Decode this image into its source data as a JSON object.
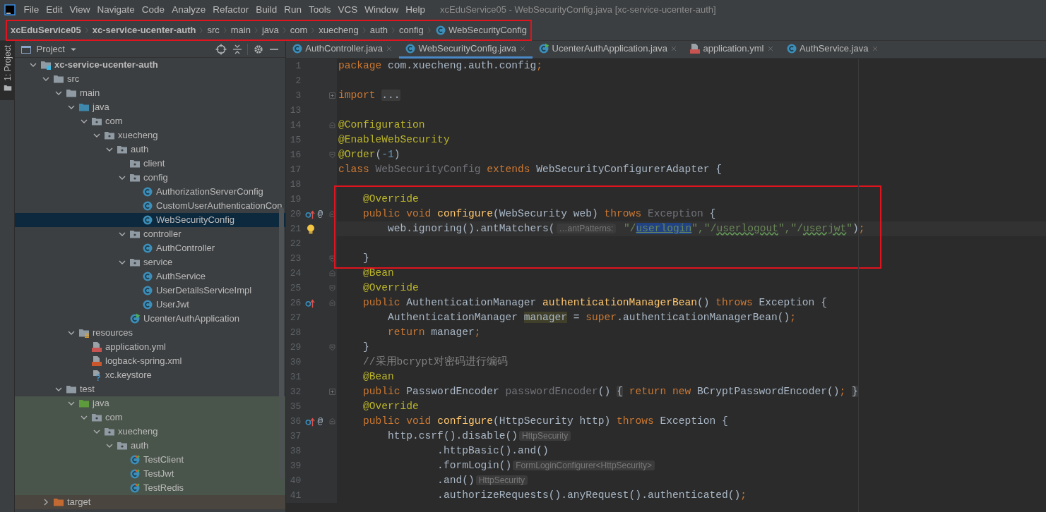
{
  "menu_bar": {
    "items": [
      "File",
      "Edit",
      "View",
      "Navigate",
      "Code",
      "Analyze",
      "Refactor",
      "Build",
      "Run",
      "Tools",
      "VCS",
      "Window",
      "Help"
    ],
    "title": "xcEduService05 - WebSecurityConfig.java [xc-service-ucenter-auth]"
  },
  "breadcrumb": {
    "outlined": true,
    "items": [
      {
        "text": "xcEduService05",
        "kind": "project"
      },
      {
        "text": "xc-service-ucenter-auth",
        "kind": "project"
      },
      {
        "text": "src",
        "kind": "dir"
      },
      {
        "text": "main",
        "kind": "dir"
      },
      {
        "text": "java",
        "kind": "dir"
      },
      {
        "text": "com",
        "kind": "dir"
      },
      {
        "text": "xuecheng",
        "kind": "dir"
      },
      {
        "text": "auth",
        "kind": "dir"
      },
      {
        "text": "config",
        "kind": "dir"
      },
      {
        "text": "WebSecurityConfig",
        "kind": "class"
      }
    ]
  },
  "tool_strip": {
    "label": "1: Project"
  },
  "project_panel": {
    "title": "Project",
    "tree": [
      {
        "label": "xc-service-ucenter-auth",
        "kind": "module",
        "expanded": true,
        "selected": false,
        "children": [
          {
            "label": "src",
            "kind": "folder",
            "expanded": true,
            "selected": false,
            "children": [
              {
                "label": "main",
                "kind": "folder",
                "expanded": true,
                "selected": false,
                "children": [
                  {
                    "label": "java",
                    "kind": "source-root",
                    "expanded": true,
                    "selected": false,
                    "children": [
                      {
                        "label": "com",
                        "kind": "package",
                        "expanded": true,
                        "selected": false,
                        "children": [
                          {
                            "label": "xuecheng",
                            "kind": "package",
                            "expanded": true,
                            "selected": false,
                            "children": [
                              {
                                "label": "auth",
                                "kind": "package",
                                "expanded": true,
                                "selected": false,
                                "children": [
                                  {
                                    "label": "client",
                                    "kind": "package",
                                    "selected": false
                                  },
                                  {
                                    "label": "config",
                                    "kind": "package",
                                    "expanded": true,
                                    "selected": false,
                                    "children": [
                                      {
                                        "label": "AuthorizationServerConfig",
                                        "kind": "class",
                                        "selected": false
                                      },
                                      {
                                        "label": "CustomUserAuthenticationCon",
                                        "kind": "class",
                                        "selected": false
                                      },
                                      {
                                        "label": "WebSecurityConfig",
                                        "kind": "class",
                                        "selected": true
                                      }
                                    ]
                                  },
                                  {
                                    "label": "controller",
                                    "kind": "package",
                                    "expanded": true,
                                    "selected": false,
                                    "children": [
                                      {
                                        "label": "AuthController",
                                        "kind": "class",
                                        "selected": false
                                      }
                                    ]
                                  },
                                  {
                                    "label": "service",
                                    "kind": "package",
                                    "expanded": true,
                                    "selected": false,
                                    "children": [
                                      {
                                        "label": "AuthService",
                                        "kind": "class",
                                        "selected": false
                                      },
                                      {
                                        "label": "UserDetailsServiceImpl",
                                        "kind": "class",
                                        "selected": false
                                      },
                                      {
                                        "label": "UserJwt",
                                        "kind": "class",
                                        "selected": false
                                      }
                                    ]
                                  },
                                  {
                                    "label": "UcenterAuthApplication",
                                    "kind": "app-class",
                                    "selected": false
                                  }
                                ]
                              }
                            ]
                          }
                        ]
                      }
                    ]
                  },
                  {
                    "label": "resources",
                    "kind": "resources",
                    "expanded": true,
                    "selected": false,
                    "children": [
                      {
                        "label": "application.yml",
                        "kind": "yml",
                        "selected": false
                      },
                      {
                        "label": "logback-spring.xml",
                        "kind": "xml",
                        "selected": false
                      },
                      {
                        "label": "xc.keystore",
                        "kind": "keystore",
                        "selected": false
                      }
                    ]
                  }
                ]
              },
              {
                "label": "test",
                "kind": "folder",
                "expanded": true,
                "selected": false,
                "children": [
                  {
                    "label": "java",
                    "kind": "test-root",
                    "expanded": true,
                    "selected": false,
                    "children": [
                      {
                        "label": "com",
                        "kind": "package",
                        "expanded": true,
                        "selected": false,
                        "children": [
                          {
                            "label": "xuecheng",
                            "kind": "package",
                            "expanded": true,
                            "selected": false,
                            "children": [
                              {
                                "label": "auth",
                                "kind": "package",
                                "expanded": true,
                                "selected": false,
                                "children": [
                                  {
                                    "label": "TestClient",
                                    "kind": "test-class",
                                    "selected": false
                                  },
                                  {
                                    "label": "TestJwt",
                                    "kind": "test-class",
                                    "selected": false
                                  },
                                  {
                                    "label": "TestRedis",
                                    "kind": "test-class",
                                    "selected": false
                                  }
                                ]
                              }
                            ]
                          }
                        ]
                      }
                    ]
                  }
                ]
              }
            ]
          },
          {
            "label": "target",
            "kind": "excluded",
            "expanded": false,
            "selected": false
          }
        ]
      }
    ]
  },
  "editor": {
    "tabs": [
      {
        "label": "AuthController.java",
        "kind": "class",
        "selected": false
      },
      {
        "label": "WebSecurityConfig.java",
        "kind": "class",
        "selected": true
      },
      {
        "label": "UcenterAuthApplication.java",
        "kind": "app-class",
        "selected": false
      },
      {
        "label": "application.yml",
        "kind": "yml",
        "selected": false
      },
      {
        "label": "AuthService.java",
        "kind": "class",
        "selected": false
      }
    ],
    "lines": [
      {
        "no": "1",
        "current": false,
        "outlined": false,
        "tokens": [
          {
            "kind": "kw",
            "text": "package"
          },
          {
            "kind": "plain",
            "text": " com.xuecheng.auth.config"
          },
          {
            "kind": "kw",
            "text": ";"
          }
        ]
      },
      {
        "no": "2",
        "current": false,
        "outlined": false
      },
      {
        "no": "3",
        "current": false,
        "outlined": false,
        "fold": {
          "kind": "collapsed"
        },
        "tokens": [
          {
            "kind": "kw",
            "text": "import "
          },
          {
            "kind": "fold",
            "text": "..."
          }
        ]
      },
      {
        "no": "13",
        "current": false,
        "outlined": false
      },
      {
        "no": "14",
        "current": false,
        "outlined": false,
        "fold": {
          "kind": "start"
        },
        "tokens": [
          {
            "kind": "ann",
            "text": "@Configuration"
          }
        ]
      },
      {
        "no": "15",
        "current": false,
        "outlined": false,
        "tokens": [
          {
            "kind": "ann",
            "text": "@EnableWebSecurity"
          }
        ]
      },
      {
        "no": "16",
        "current": false,
        "outlined": false,
        "fold": {
          "kind": "end"
        },
        "tokens": [
          {
            "kind": "ann",
            "text": "@Order"
          },
          {
            "kind": "plain",
            "text": "("
          },
          {
            "kind": "num",
            "text": "-1"
          },
          {
            "kind": "plain",
            "text": ")"
          }
        ]
      },
      {
        "no": "17",
        "current": false,
        "outlined": false,
        "tokens": [
          {
            "kind": "kw",
            "text": "class "
          },
          {
            "kind": "unused",
            "text": "WebSecurityConfig"
          },
          {
            "kind": "kw",
            "text": " extends"
          },
          {
            "kind": "plain",
            "text": " WebSecurityConfigurerAdapter {"
          }
        ]
      },
      {
        "no": "18",
        "current": false,
        "outlined": false
      },
      {
        "no": "19",
        "current": false,
        "outlined": true,
        "tokens": [
          {
            "kind": "ann",
            "text": "    @Override"
          }
        ]
      },
      {
        "no": "20",
        "current": false,
        "outlined": true,
        "gutter_icon": {
          "kind": "override"
        },
        "gutter_mark": "@",
        "fold": {
          "kind": "start"
        },
        "tokens": [
          {
            "kind": "kw",
            "text": "    public void"
          },
          {
            "kind": "decl",
            "text": " configure"
          },
          {
            "kind": "plain",
            "text": "(WebSecurity web) "
          },
          {
            "kind": "kw",
            "text": "throws"
          },
          {
            "kind": "unused",
            "text": " Exception"
          },
          {
            "kind": "plain",
            "text": " {"
          }
        ]
      },
      {
        "no": "21",
        "current": true,
        "outlined": true,
        "gutter_icon": {
          "kind": "bulb"
        },
        "tokens": [
          {
            "kind": "plain",
            "text": "        web.ignoring().antMatchers("
          },
          {
            "kind": "hint",
            "text": "…antPatterns:"
          },
          {
            "kind": "str",
            "text": " \"/"
          },
          {
            "kind": "selected",
            "text": "userlogin"
          },
          {
            "kind": "str",
            "text": "\",\"/"
          },
          {
            "kind": "typo",
            "text": "userlogout"
          },
          {
            "kind": "str",
            "text": "\",\"/"
          },
          {
            "kind": "typo",
            "text": "userjwt"
          },
          {
            "kind": "str",
            "text": "\""
          },
          {
            "kind": "plain",
            "text": ")"
          },
          {
            "kind": "kw",
            "text": ";"
          }
        ]
      },
      {
        "no": "22",
        "current": false,
        "outlined": true
      },
      {
        "no": "23",
        "current": false,
        "outlined": true,
        "fold": {
          "kind": "end"
        },
        "tokens": [
          {
            "kind": "plain",
            "text": "    }"
          }
        ]
      },
      {
        "no": "24",
        "current": false,
        "outlined": false,
        "fold": {
          "kind": "start"
        },
        "tokens": [
          {
            "kind": "ann",
            "text": "    @Bean"
          }
        ]
      },
      {
        "no": "25",
        "current": false,
        "outlined": false,
        "fold": {
          "kind": "end"
        },
        "tokens": [
          {
            "kind": "ann",
            "text": "    @Override"
          }
        ]
      },
      {
        "no": "26",
        "current": false,
        "outlined": false,
        "gutter_icon": {
          "kind": "override"
        },
        "fold": {
          "kind": "start"
        },
        "tokens": [
          {
            "kind": "kw",
            "text": "    public"
          },
          {
            "kind": "plain",
            "text": " AuthenticationManager "
          },
          {
            "kind": "decl",
            "text": "authenticationManagerBean"
          },
          {
            "kind": "plain",
            "text": "() "
          },
          {
            "kind": "kw",
            "text": "throws"
          },
          {
            "kind": "plain",
            "text": " Exception {"
          }
        ]
      },
      {
        "no": "27",
        "current": false,
        "outlined": false,
        "tokens": [
          {
            "kind": "plain",
            "text": "        AuthenticationManager "
          },
          {
            "kind": "usage",
            "text": "manager"
          },
          {
            "kind": "plain",
            "text": " = "
          },
          {
            "kind": "kw",
            "text": "super"
          },
          {
            "kind": "plain",
            "text": ".authenticationManagerBean()"
          },
          {
            "kind": "kw",
            "text": ";"
          }
        ]
      },
      {
        "no": "28",
        "current": false,
        "outlined": false,
        "tokens": [
          {
            "kind": "kw",
            "text": "        return"
          },
          {
            "kind": "plain",
            "text": " manager"
          },
          {
            "kind": "kw",
            "text": ";"
          }
        ]
      },
      {
        "no": "29",
        "current": false,
        "outlined": false,
        "fold": {
          "kind": "end"
        },
        "tokens": [
          {
            "kind": "plain",
            "text": "    }"
          }
        ]
      },
      {
        "no": "30",
        "current": false,
        "outlined": false,
        "tokens": [
          {
            "kind": "comment",
            "text": "    //采用bcrypt对密码进行编码"
          }
        ]
      },
      {
        "no": "31",
        "current": false,
        "outlined": false,
        "tokens": [
          {
            "kind": "ann",
            "text": "    @Bean"
          }
        ]
      },
      {
        "no": "32",
        "current": false,
        "outlined": false,
        "fold": {
          "kind": "collapsed"
        },
        "tokens": [
          {
            "kind": "kw",
            "text": "    public"
          },
          {
            "kind": "plain",
            "text": " PasswordEncoder "
          },
          {
            "kind": "unused",
            "text": "passwordEncoder"
          },
          {
            "kind": "plain",
            "text": "() "
          },
          {
            "kind": "fold",
            "text": "{"
          },
          {
            "kind": "kw",
            "text": " return new"
          },
          {
            "kind": "plain",
            "text": " BCryptPasswordEncoder()"
          },
          {
            "kind": "kw",
            "text": "; "
          },
          {
            "kind": "fold",
            "text": "}"
          }
        ]
      },
      {
        "no": "35",
        "current": false,
        "outlined": false,
        "tokens": [
          {
            "kind": "ann",
            "text": "    @Override"
          }
        ]
      },
      {
        "no": "36",
        "current": false,
        "outlined": false,
        "gutter_icon": {
          "kind": "override"
        },
        "gutter_mark": "@",
        "fold": {
          "kind": "start"
        },
        "tokens": [
          {
            "kind": "kw",
            "text": "    public void"
          },
          {
            "kind": "decl",
            "text": " configure"
          },
          {
            "kind": "plain",
            "text": "(HttpSecurity http) "
          },
          {
            "kind": "kw",
            "text": "throws"
          },
          {
            "kind": "plain",
            "text": " Exception {"
          }
        ]
      },
      {
        "no": "37",
        "current": false,
        "outlined": false,
        "tokens": [
          {
            "kind": "plain",
            "text": "        http.csrf().disable()"
          },
          {
            "kind": "hint",
            "text": "HttpSecurity"
          }
        ]
      },
      {
        "no": "38",
        "current": false,
        "outlined": false,
        "tokens": [
          {
            "kind": "plain",
            "text": "                .httpBasic().and()"
          }
        ]
      },
      {
        "no": "39",
        "current": false,
        "outlined": false,
        "tokens": [
          {
            "kind": "plain",
            "text": "                .formLogin()"
          },
          {
            "kind": "hint",
            "text": "FormLoginConfigurer<HttpSecurity>"
          }
        ]
      },
      {
        "no": "40",
        "current": false,
        "outlined": false,
        "tokens": [
          {
            "kind": "plain",
            "text": "                .and()"
          },
          {
            "kind": "hint",
            "text": "HttpSecurity"
          }
        ]
      },
      {
        "no": "41",
        "current": false,
        "outlined": false,
        "tokens": [
          {
            "kind": "plain",
            "text": "                .authorizeRequests().anyRequest().authenticated()"
          },
          {
            "kind": "kw",
            "text": ";"
          }
        ]
      }
    ]
  }
}
